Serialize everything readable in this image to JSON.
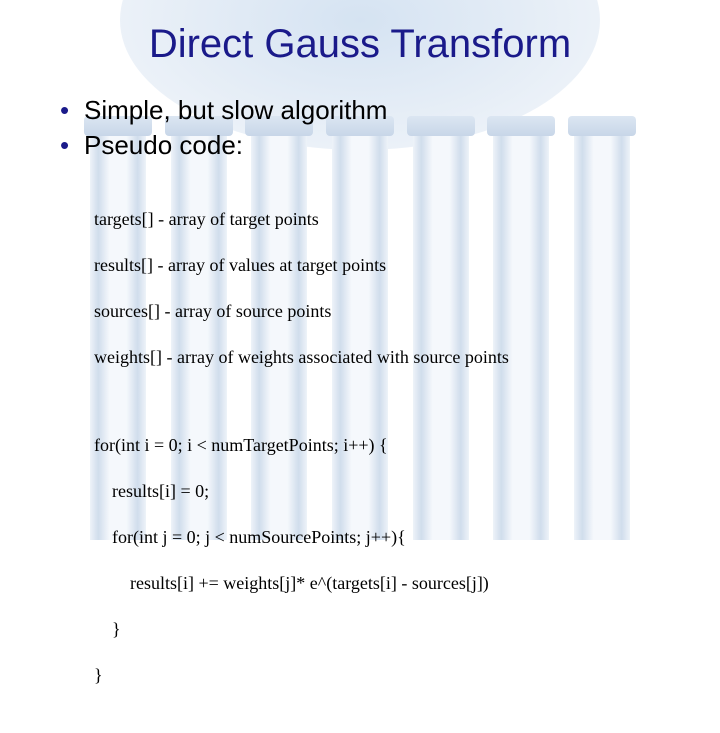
{
  "title": "Direct Gauss Transform",
  "bullets": [
    "Simple, but slow algorithm",
    "Pseudo code:"
  ],
  "defs": [
    "targets[] - array of target points",
    "results[] - array of values at target points",
    "sources[] - array of source points",
    "weights[] - array of weights associated with source points"
  ],
  "code": [
    "for(int i = 0; i < numTargetPoints; i++) {",
    "    results[i] = 0;",
    "    for(int j = 0; j < numSourcePoints; j++){",
    "        results[i] += weights[j]* e^(targets[i] - sources[j])",
    "    }",
    "}"
  ]
}
